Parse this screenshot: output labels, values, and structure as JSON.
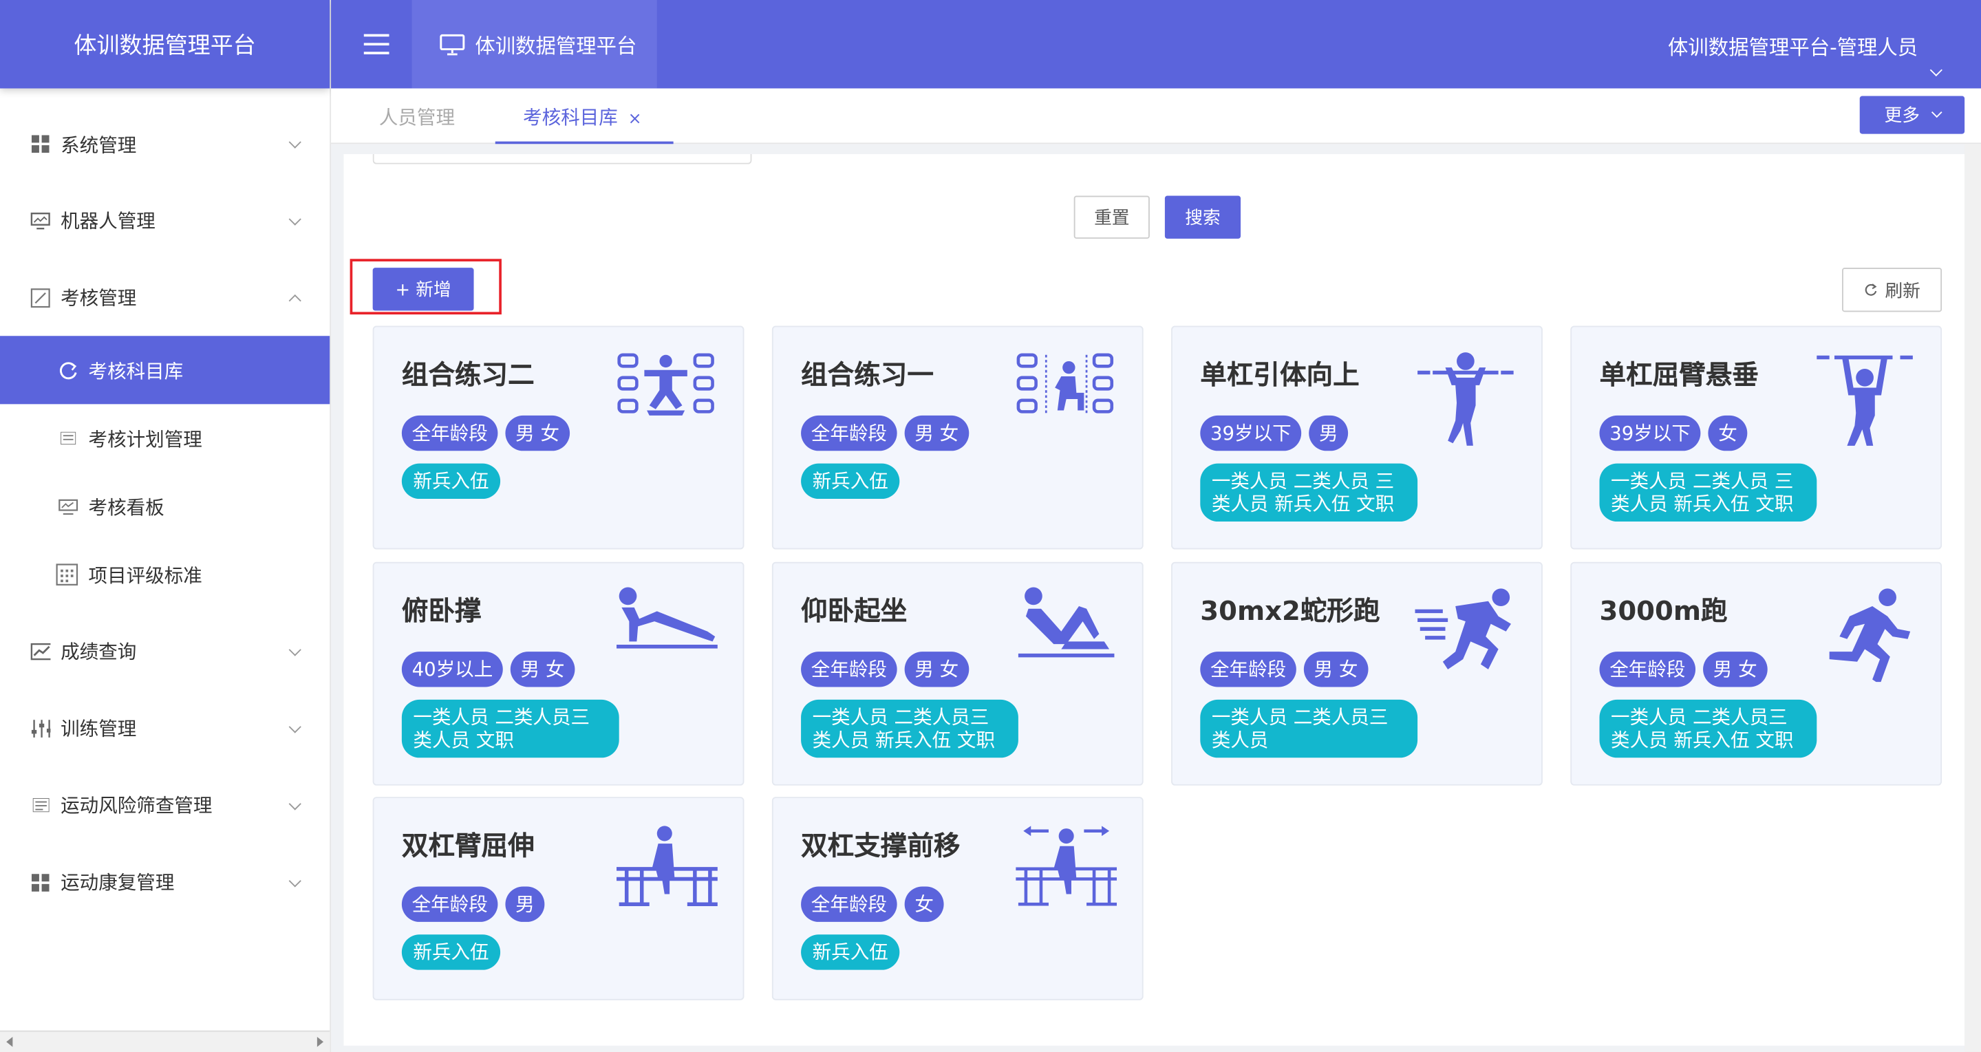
{
  "app": {
    "title": "体训数据管理平台"
  },
  "header": {
    "tab_title": "体训数据管理平台",
    "user": "体训数据管理平台-管理人员"
  },
  "sidebar": {
    "items": [
      {
        "label": "系统管理",
        "icon": "grid-icon"
      },
      {
        "label": "机器人管理",
        "icon": "monitor-icon"
      },
      {
        "label": "考核管理",
        "icon": "edit-icon",
        "expanded": true,
        "children": [
          {
            "label": "考核科目库",
            "icon": "refresh-circle-icon",
            "active": true
          },
          {
            "label": "考核计划管理",
            "icon": "list-icon"
          },
          {
            "label": "考核看板",
            "icon": "monitor-icon"
          },
          {
            "label": "项目评级标准",
            "icon": "calendar-icon"
          }
        ]
      },
      {
        "label": "成绩查询",
        "icon": "chart-icon"
      },
      {
        "label": "训练管理",
        "icon": "sliders-icon"
      },
      {
        "label": "运动风险筛查管理",
        "icon": "list-icon"
      },
      {
        "label": "运动康复管理",
        "icon": "grid-icon"
      }
    ]
  },
  "tabs": [
    {
      "label": "人员管理"
    },
    {
      "label": "考核科目库",
      "active": true,
      "close": "×"
    }
  ],
  "toolbar": {
    "more": "更多",
    "reset": "重置",
    "search": "搜索",
    "add": "+ 新增",
    "refresh": "刷新"
  },
  "colors": {
    "primary": "#5b64dc",
    "teal": "#13b7ce",
    "highlight": "#e8222a"
  },
  "cards": [
    {
      "title": "组合练习二",
      "tags": [
        "全年龄段",
        "男 女"
      ],
      "groups": "新兵入伍",
      "icon": "combo-exercise-icon"
    },
    {
      "title": "组合练习一",
      "tags": [
        "全年龄段",
        "男 女"
      ],
      "groups": "新兵入伍",
      "icon": "combo-exercise-icon"
    },
    {
      "title": "单杠引体向上",
      "tags": [
        "39岁以下",
        "男"
      ],
      "groups": "一类人员 二类人员 三类人员 新兵入伍 文职",
      "icon": "pull-up-icon"
    },
    {
      "title": "单杠屈臂悬垂",
      "tags": [
        "39岁以下",
        "女"
      ],
      "groups": "一类人员 二类人员 三类人员 新兵入伍 文职",
      "icon": "hang-icon"
    },
    {
      "title": "俯卧撑",
      "tags": [
        "40岁以上",
        "男 女"
      ],
      "groups": "一类人员 二类人员三类人员 文职",
      "icon": "push-up-icon"
    },
    {
      "title": "仰卧起坐",
      "tags": [
        "全年龄段",
        "男 女"
      ],
      "groups": "一类人员 二类人员三类人员 新兵入伍 文职",
      "icon": "sit-up-icon"
    },
    {
      "title": "30mx2蛇形跑",
      "tags": [
        "全年龄段",
        "男 女"
      ],
      "groups": "一类人员 二类人员三类人员",
      "icon": "sprint-icon"
    },
    {
      "title": "3000m跑",
      "tags": [
        "全年龄段",
        "男 女"
      ],
      "groups": "一类人员 二类人员三类人员 新兵入伍 文职",
      "icon": "run-icon"
    },
    {
      "title": "双杠臂屈伸",
      "tags": [
        "全年龄段",
        "男"
      ],
      "groups": "新兵入伍",
      "icon": "parallel-bars-icon"
    },
    {
      "title": "双杠支撑前移",
      "tags": [
        "全年龄段",
        "女"
      ],
      "groups": "新兵入伍",
      "icon": "parallel-bars-move-icon"
    }
  ]
}
